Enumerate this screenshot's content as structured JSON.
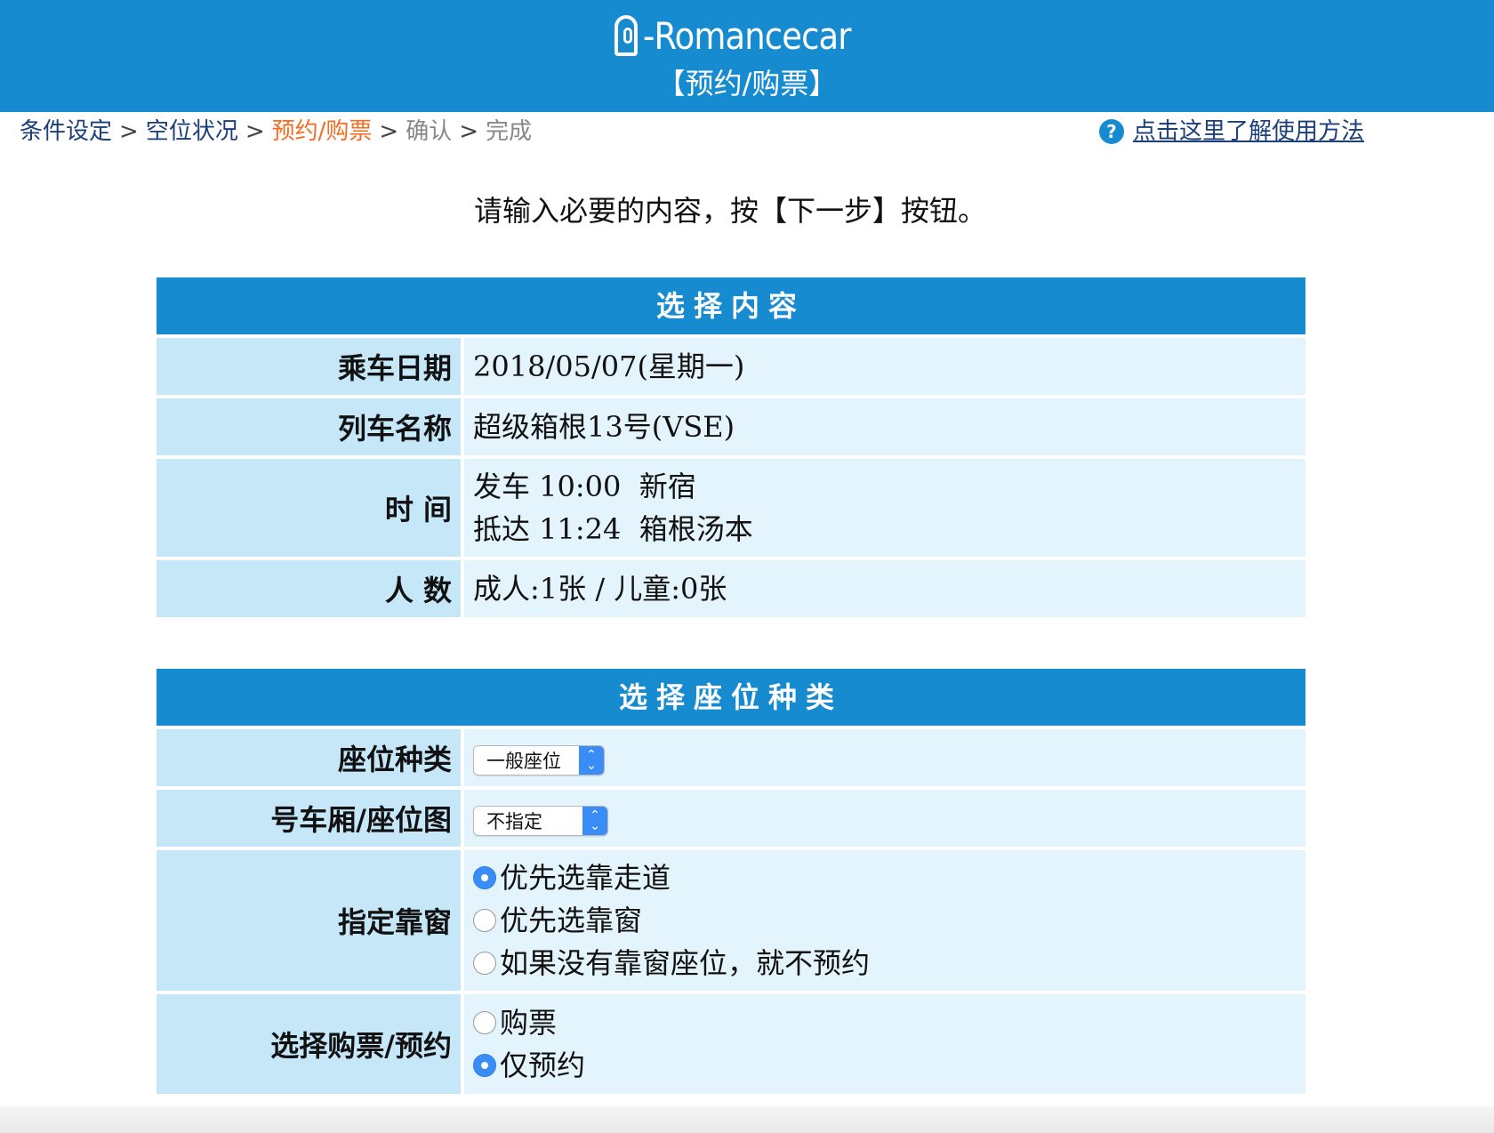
{
  "header": {
    "logo_text": "-Romancecar",
    "subtitle": "【预约/购票】"
  },
  "breadcrumb": {
    "step1": "条件设定",
    "step2": "空位状况",
    "step3": "预约/购票",
    "step4": "确认",
    "step5": "完成",
    "separator": ">"
  },
  "help": {
    "icon": "question-icon",
    "label": "点击这里了解使用方法"
  },
  "instruction": "请输入必要的内容，按【下一步】按钮。",
  "selection": {
    "title": "选择内容",
    "date_label": "乘车日期",
    "date_value": "2018/05/07(星期一)",
    "train_label": "列车名称",
    "train_value": "超级箱根13号(VSE)",
    "time_label": "时 间",
    "depart_value": "发车 10:00  新宿",
    "arrive_value": "抵达 11:24  箱根汤本",
    "people_label": "人 数",
    "people_value": "成人:1张 / 儿童:0张"
  },
  "seat": {
    "title": "选择座位种类",
    "type_label": "座位种类",
    "type_selected": "一般座位",
    "car_label": "号车厢/座位图",
    "car_selected": "不指定",
    "window_label": "指定靠窗",
    "window_options": [
      "优先选靠走道",
      "优先选靠窗",
      "如果没有靠窗座位，就不预约"
    ],
    "window_checked": 0,
    "purchase_label": "选择购票/预约",
    "purchase_options": [
      "购票",
      "仅预约"
    ],
    "purchase_checked": 1
  },
  "colors": {
    "header_blue": "#178bd0",
    "label_bg": "#c5e7f8",
    "value_bg": "#e4f4fc",
    "current_step": "#f36c21"
  }
}
